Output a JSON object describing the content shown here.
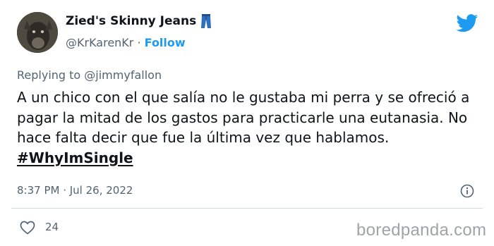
{
  "author": {
    "display_name": "Zied's Skinny Jeans",
    "name_emoji_icon": "jeans-icon",
    "handle": "@KrKarenKr",
    "separator": "·",
    "follow_label": "Follow"
  },
  "header": {
    "logo_icon": "twitter-bird-icon"
  },
  "tweet": {
    "replying_to": "Replying to @jimmyfallon",
    "text": "A un chico con el que salía no le gustaba mi perra y se ofreció a pagar la mitad de los gastos para practicarle una eutanasia. No hace falta decir que fue la última vez que hablamos.",
    "hashtag": "#WhyImSingle",
    "timestamp": "8:37 PM · Jul 26, 2022"
  },
  "actions": {
    "like_icon": "heart-icon",
    "like_count": "24",
    "info_icon": "info-icon"
  },
  "watermark": "boredpanda.com",
  "colors": {
    "accent": "#1d9bf0",
    "text": "#0f1419",
    "secondary": "#536471",
    "divider": "#cfd9de"
  }
}
